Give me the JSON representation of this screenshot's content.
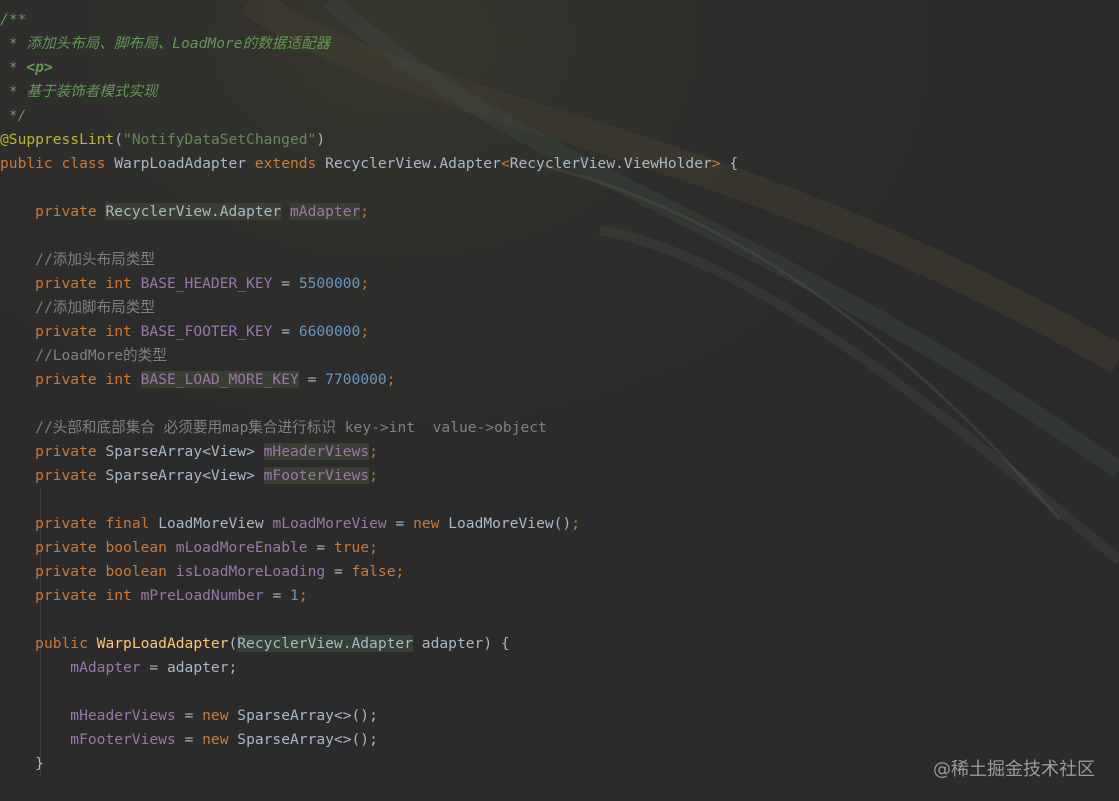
{
  "code": {
    "doc_open": "/**",
    "doc_line1": " * 添加头布局、脚布局、LoadMore的数据适配器",
    "doc_p_prefix": " * ",
    "doc_p_tag": "<p>",
    "doc_line3": " * 基于装饰者模式实现",
    "doc_close": " */",
    "annotation": "@SuppressLint",
    "annotation_paren_open": "(",
    "annotation_arg": "\"NotifyDataSetChanged\"",
    "annotation_paren_close": ")",
    "kw_public": "public",
    "kw_class": "class",
    "class_name": "WarpLoadAdapter",
    "kw_extends": "extends",
    "super_type": "RecyclerView.Adapter",
    "generic_open": "<",
    "generic_type": "RecyclerView.ViewHolder",
    "generic_close": ">",
    "brace_open": "{",
    "kw_private": "private",
    "kw_int": "int",
    "kw_final": "final",
    "kw_boolean": "boolean",
    "kw_new": "new",
    "kw_true": "true",
    "kw_false": "false",
    "type_adapter": "RecyclerView.Adapter",
    "field_adapter": "mAdapter",
    "semicolon": ";",
    "comment_header": "//添加头布局类型",
    "field_header_key": "BASE_HEADER_KEY",
    "eq": "=",
    "val_header_key": "5500000",
    "comment_footer": "//添加脚布局类型",
    "field_footer_key": "BASE_FOOTER_KEY",
    "val_footer_key": "6600000",
    "comment_loadmore": "//LoadMore的类型",
    "field_loadmore_key": "BASE_LOAD_MORE_KEY",
    "val_loadmore_key": "7700000",
    "comment_map": "//头部和底部集合 必须要用map集合进行标识 key->int  value->object",
    "type_sparse_view": "SparseArray<View>",
    "field_header_views": "mHeaderViews",
    "field_footer_views": "mFooterViews",
    "type_loadmore_view": "LoadMoreView",
    "field_loadmore_view": "mLoadMoreView",
    "ctor_loadmore_view": "LoadMoreView",
    "call_parens": "()",
    "field_loadmore_enable": "mLoadMoreEnable",
    "field_is_loading": "isLoadMoreLoading",
    "field_preload": "mPreLoadNumber",
    "val_preload": "1",
    "ctor_name": "WarpLoadAdapter",
    "paren_open": "(",
    "param_type": "RecyclerView.Adapter",
    "param_name": "adapter",
    "paren_close_brace": ") {",
    "assign_adapter_lhs": "mAdapter",
    "assign_adapter_rhs": "adapter;",
    "sparse_ctor": "SparseArray<>",
    "call_end": "();",
    "brace_close": "}"
  },
  "watermark": "@稀土掘金技术社区",
  "colors": {
    "background": "#2b2b2b",
    "keyword": "#cc7832",
    "doc_comment": "#629755",
    "line_comment": "#808080",
    "annotation": "#bbb529",
    "string": "#6a8759",
    "number": "#6897bb",
    "field": "#9876aa",
    "method": "#ffc66d",
    "text": "#a9b7c6"
  }
}
